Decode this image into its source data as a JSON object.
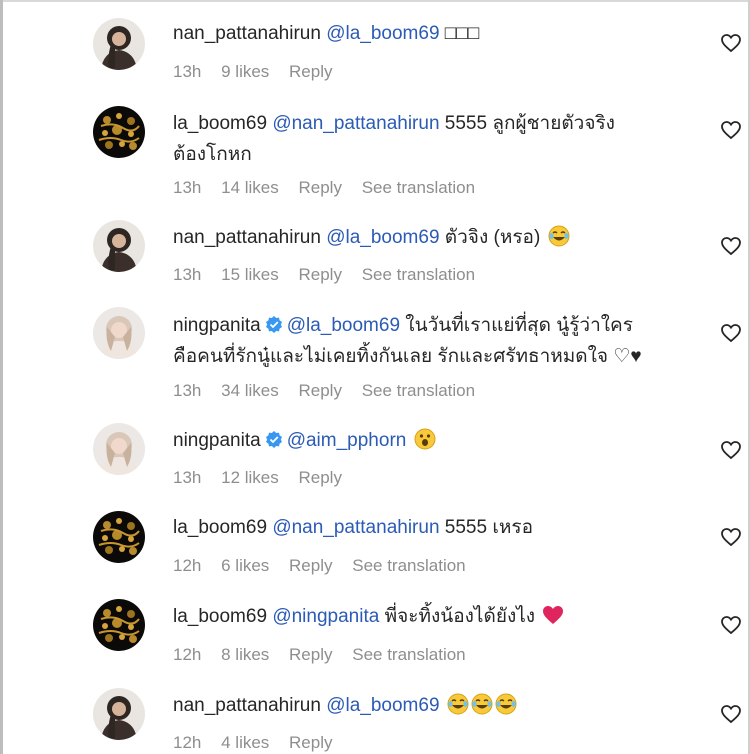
{
  "comments": [
    {
      "username": "nan_pattanahirun",
      "mention": "@la_boom69",
      "text": "□□□",
      "text2": "",
      "time": "13h",
      "likes": "9 likes",
      "reply": "Reply",
      "translate": "",
      "avatar": "woman-dark-hair"
    },
    {
      "username": "la_boom69",
      "mention": "@nan_pattanahirun",
      "text": "5555 ลูกผู้ชายตัวจริง",
      "text2": "ต้องโกหก",
      "time": "13h",
      "likes": "14 likes",
      "reply": "Reply",
      "translate": "See translation",
      "avatar": "gold-pattern"
    },
    {
      "username": "nan_pattanahirun",
      "mention": "@la_boom69",
      "text": "ตัวจิง (หรอ)",
      "text2": "",
      "time": "13h",
      "likes": "15 likes",
      "reply": "Reply",
      "translate": "See translation",
      "avatar": "woman-dark-hair"
    },
    {
      "username": "ningpanita",
      "mention": "@la_boom69",
      "text": "ในวันที่เราแย่ที่สุด นู๋รู้ว่าใคร",
      "text2": "คือคนที่รักนู๋และไม่เคยทิ้งกันเลย รักและศรัทธาหมดใจ ♡♥",
      "time": "13h",
      "likes": "34 likes",
      "reply": "Reply",
      "translate": "See translation",
      "avatar": "woman-light-hair"
    },
    {
      "username": "ningpanita",
      "mention": "@aim_pphorn",
      "text": "",
      "text2": "",
      "time": "13h",
      "likes": "12 likes",
      "reply": "Reply",
      "translate": "",
      "avatar": "woman-light-hair"
    },
    {
      "username": "la_boom69",
      "mention": "@nan_pattanahirun",
      "text": "5555 เหรอ",
      "text2": "",
      "time": "12h",
      "likes": "6 likes",
      "reply": "Reply",
      "translate": "See translation",
      "avatar": "gold-pattern"
    },
    {
      "username": "la_boom69",
      "mention": "@ningpanita",
      "text": "พี่จะทิ้งน้องได้ยังไง",
      "text2": "",
      "time": "12h",
      "likes": "8 likes",
      "reply": "Reply",
      "translate": "See translation",
      "avatar": "gold-pattern"
    },
    {
      "username": "nan_pattanahirun",
      "mention": "@la_boom69",
      "text": "",
      "text2": "",
      "time": "12h",
      "likes": "4 likes",
      "reply": "Reply",
      "translate": "",
      "avatar": "woman-dark-hair"
    }
  ],
  "colors": {
    "mention": "#2b5bb5",
    "meta": "#8e8e8e",
    "verified": "#3897f0",
    "heart_red": "#e0245e"
  },
  "icons": {
    "like": "heart-outline-icon",
    "verified": "verified-badge-icon"
  }
}
